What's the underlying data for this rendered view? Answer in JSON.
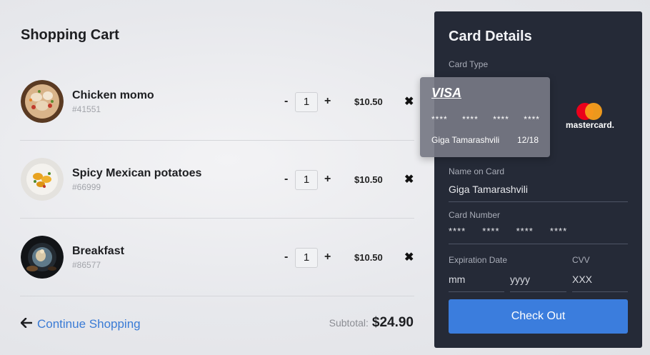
{
  "cart": {
    "title": "Shopping Cart",
    "items": [
      {
        "name": "Chicken momo",
        "id": "#41551",
        "minus": "-",
        "qty": "1",
        "plus": "+",
        "price": "$10.50",
        "remove": "✖"
      },
      {
        "name": "Spicy Mexican potatoes",
        "id": "#66999",
        "minus": "-",
        "qty": "1",
        "plus": "+",
        "price": "$10.50",
        "remove": "✖"
      },
      {
        "name": "Breakfast",
        "id": "#86577",
        "minus": "-",
        "qty": "1",
        "plus": "+",
        "price": "$10.50",
        "remove": "✖"
      }
    ],
    "continue_label": "Continue Shopping",
    "continue_icon": "🡐",
    "subtotal_label": "Subtotal:",
    "subtotal_value": "$24.90"
  },
  "card": {
    "title": "Card Details",
    "card_type_label": "Card Type",
    "visa": {
      "logo": "VISA",
      "number_groups": [
        "****",
        "****",
        "****",
        "****"
      ],
      "holder": "Giga Tamarashvili",
      "expiry": "12/18"
    },
    "mastercard_label": "mastercard.",
    "name_label": "Name on Card",
    "name_value": "Giga Tamarashvili",
    "number_label": "Card Number",
    "number_value": "****     ****     ****     ****",
    "expiry_label": "Expiration Date",
    "month_placeholder": "mm",
    "year_placeholder": "yyyy",
    "cvv_label": "CVV",
    "cvv_placeholder": "XXX",
    "checkout_label": "Check Out"
  },
  "colors": {
    "panel_bg": "#252a37",
    "accent_blue": "#3b7ddd",
    "link_blue": "#3a7bd5",
    "mastercard_red": "#eb001b",
    "mastercard_orange": "#f79e1b"
  }
}
